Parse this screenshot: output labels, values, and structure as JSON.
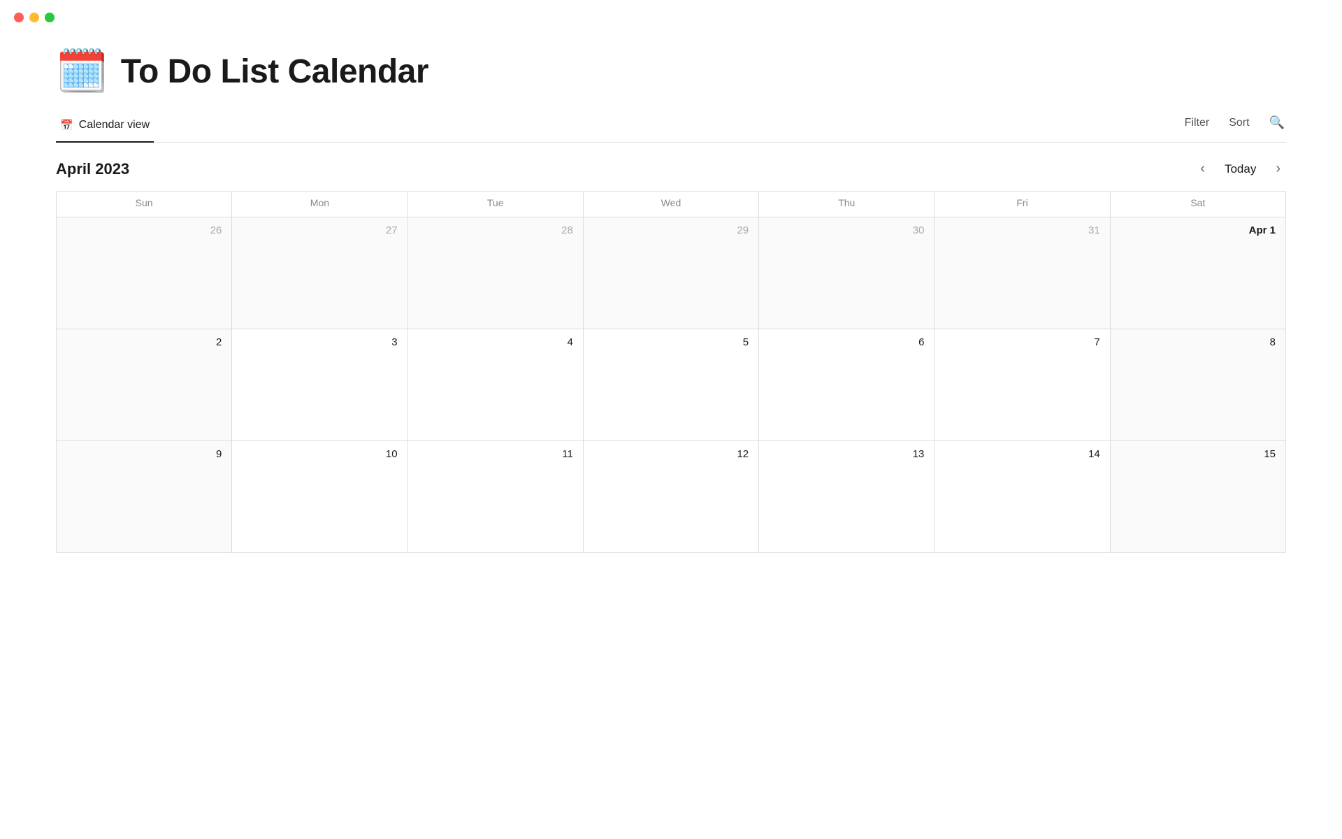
{
  "window": {
    "traffic_lights": [
      "red",
      "yellow",
      "green"
    ]
  },
  "header": {
    "icon": "🗓️",
    "title": "To Do List Calendar"
  },
  "toolbar": {
    "active_view": "Calendar view",
    "views": [
      {
        "id": "calendar",
        "label": "Calendar view",
        "icon": "📅"
      }
    ],
    "filter_label": "Filter",
    "sort_label": "Sort",
    "search_icon": "🔍"
  },
  "calendar": {
    "month_label": "April 2023",
    "today_label": "Today",
    "prev_label": "‹",
    "next_label": "›",
    "day_headers": [
      "Sun",
      "Mon",
      "Tue",
      "Wed",
      "Thu",
      "Fri",
      "Sat"
    ],
    "weeks": [
      [
        {
          "date": "26",
          "other_month": true,
          "weekend": false
        },
        {
          "date": "27",
          "other_month": true,
          "weekend": false
        },
        {
          "date": "28",
          "other_month": true,
          "weekend": false
        },
        {
          "date": "29",
          "other_month": true,
          "weekend": false
        },
        {
          "date": "30",
          "other_month": true,
          "weekend": false
        },
        {
          "date": "31",
          "other_month": true,
          "weekend": false
        },
        {
          "date": "Apr 1",
          "other_month": false,
          "weekend": true,
          "first": true
        }
      ],
      [
        {
          "date": "2",
          "other_month": false,
          "weekend": true
        },
        {
          "date": "3",
          "other_month": false,
          "weekend": false
        },
        {
          "date": "4",
          "other_month": false,
          "weekend": false
        },
        {
          "date": "5",
          "other_month": false,
          "weekend": false
        },
        {
          "date": "6",
          "other_month": false,
          "weekend": false
        },
        {
          "date": "7",
          "other_month": false,
          "weekend": false
        },
        {
          "date": "8",
          "other_month": false,
          "weekend": true
        }
      ],
      [
        {
          "date": "9",
          "other_month": false,
          "weekend": true
        },
        {
          "date": "10",
          "other_month": false,
          "weekend": false
        },
        {
          "date": "11",
          "other_month": false,
          "weekend": false
        },
        {
          "date": "12",
          "other_month": false,
          "weekend": false
        },
        {
          "date": "13",
          "other_month": false,
          "weekend": false
        },
        {
          "date": "14",
          "other_month": false,
          "weekend": false
        },
        {
          "date": "15",
          "other_month": false,
          "weekend": true
        }
      ]
    ]
  }
}
